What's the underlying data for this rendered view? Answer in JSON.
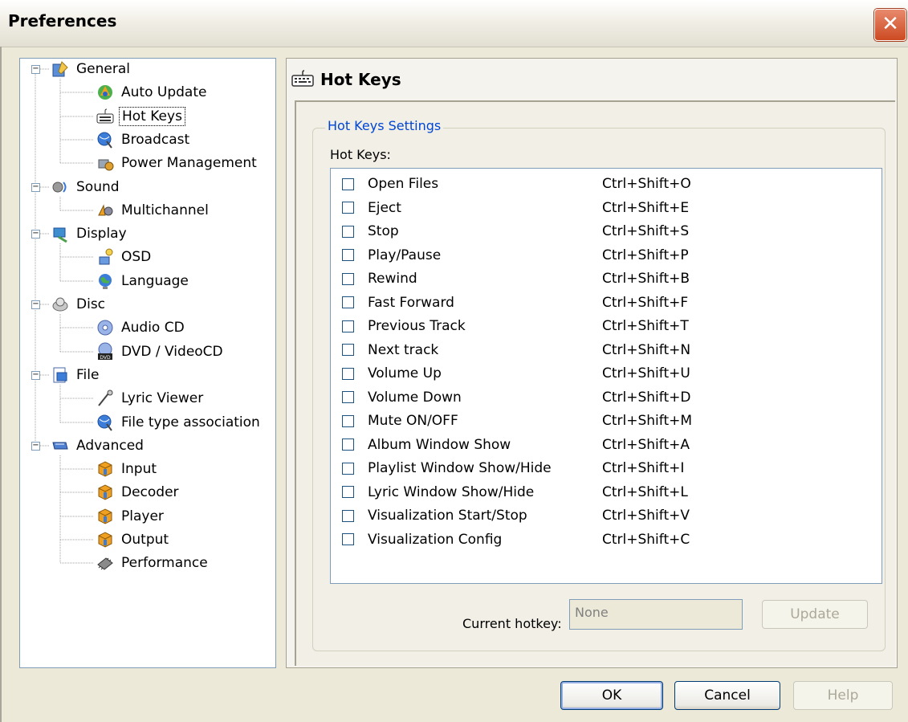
{
  "window": {
    "title": "Preferences",
    "close_symbol": "✕"
  },
  "tree": {
    "nodes": [
      {
        "label": "General",
        "icon": "general-icon",
        "level": 0,
        "expanded": true
      },
      {
        "label": "Auto Update",
        "icon": "auto-update-icon",
        "level": 1
      },
      {
        "label": "Hot Keys",
        "icon": "keyboard-icon",
        "level": 1,
        "selected": true
      },
      {
        "label": "Broadcast",
        "icon": "broadcast-icon",
        "level": 1
      },
      {
        "label": "Power Management",
        "icon": "power-management-icon",
        "level": 1
      },
      {
        "label": "Sound",
        "icon": "sound-icon",
        "level": 0,
        "expanded": true
      },
      {
        "label": "Multichannel",
        "icon": "multichannel-icon",
        "level": 1
      },
      {
        "label": "Display",
        "icon": "display-icon",
        "level": 0,
        "expanded": true
      },
      {
        "label": "OSD",
        "icon": "osd-icon",
        "level": 1
      },
      {
        "label": "Language",
        "icon": "language-icon",
        "level": 1
      },
      {
        "label": "Disc",
        "icon": "disc-icon",
        "level": 0,
        "expanded": true
      },
      {
        "label": "Audio CD",
        "icon": "audio-cd-icon",
        "level": 1
      },
      {
        "label": "DVD / VideoCD",
        "icon": "dvd-icon",
        "level": 1
      },
      {
        "label": "File",
        "icon": "file-icon",
        "level": 0,
        "expanded": true
      },
      {
        "label": "Lyric Viewer",
        "icon": "lyric-viewer-icon",
        "level": 1
      },
      {
        "label": "File type association",
        "icon": "file-type-association-icon",
        "level": 1
      },
      {
        "label": "Advanced",
        "icon": "advanced-icon",
        "level": 0,
        "expanded": true
      },
      {
        "label": "Input",
        "icon": "input-plugin-icon",
        "level": 1
      },
      {
        "label": "Decoder",
        "icon": "decoder-plugin-icon",
        "level": 1
      },
      {
        "label": "Player",
        "icon": "player-plugin-icon",
        "level": 1
      },
      {
        "label": "Output",
        "icon": "output-plugin-icon",
        "level": 1
      },
      {
        "label": "Performance",
        "icon": "performance-chip-icon",
        "level": 1
      }
    ]
  },
  "panel": {
    "title": "Hot Keys",
    "group_label": "Hot Keys Settings",
    "list_label": "Hot Keys:",
    "hotkeys": [
      {
        "name": "Open Files",
        "key": "Ctrl+Shift+O",
        "checked": false
      },
      {
        "name": "Eject",
        "key": "Ctrl+Shift+E",
        "checked": false
      },
      {
        "name": "Stop",
        "key": "Ctrl+Shift+S",
        "checked": false
      },
      {
        "name": "Play/Pause",
        "key": "Ctrl+Shift+P",
        "checked": false
      },
      {
        "name": "Rewind",
        "key": "Ctrl+Shift+B",
        "checked": false
      },
      {
        "name": "Fast Forward",
        "key": "Ctrl+Shift+F",
        "checked": false
      },
      {
        "name": "Previous Track",
        "key": "Ctrl+Shift+T",
        "checked": false
      },
      {
        "name": "Next track",
        "key": "Ctrl+Shift+N",
        "checked": false
      },
      {
        "name": "Volume Up",
        "key": "Ctrl+Shift+U",
        "checked": false
      },
      {
        "name": "Volume Down",
        "key": "Ctrl+Shift+D",
        "checked": false
      },
      {
        "name": "Mute ON/OFF",
        "key": "Ctrl+Shift+M",
        "checked": false
      },
      {
        "name": "Album Window Show",
        "key": "Ctrl+Shift+A",
        "checked": false
      },
      {
        "name": "Playlist Window Show/Hide",
        "key": "Ctrl+Shift+I",
        "checked": false
      },
      {
        "name": "Lyric Window Show/Hide",
        "key": "Ctrl+Shift+L",
        "checked": false
      },
      {
        "name": "Visualization Start/Stop",
        "key": "Ctrl+Shift+V",
        "checked": false
      },
      {
        "name": "Visualization Config",
        "key": "Ctrl+Shift+C",
        "checked": false
      }
    ],
    "current_hotkey_label": "Current hotkey:",
    "current_hotkey_value": "None",
    "update_label": "Update"
  },
  "buttons": {
    "ok": "OK",
    "cancel": "Cancel",
    "help": "Help"
  },
  "colors": {
    "face": "#ECE9D8",
    "group_label": "#0046D5",
    "list_border": "#7F9DB9"
  }
}
